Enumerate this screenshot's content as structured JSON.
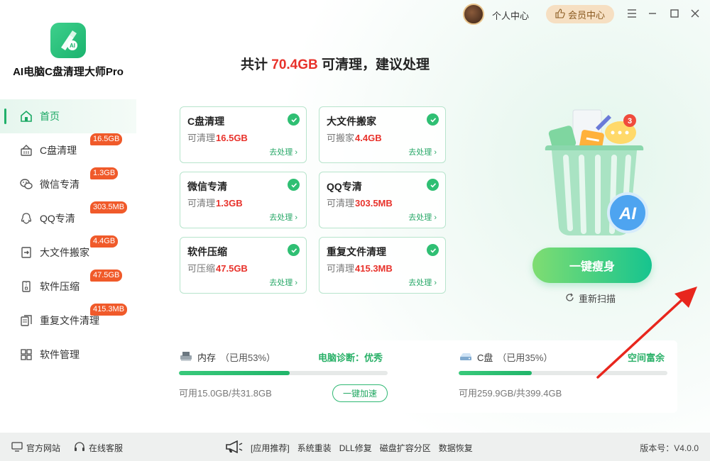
{
  "app": {
    "title": "AI电脑C盘清理大师Pro"
  },
  "topbar": {
    "user_center": "个人中心",
    "vip": "会员中心"
  },
  "sidebar": {
    "items": [
      {
        "label": "首页",
        "badge": ""
      },
      {
        "label": "C盘清理",
        "badge": "16.5GB"
      },
      {
        "label": "微信专清",
        "badge": "1.3GB"
      },
      {
        "label": "QQ专清",
        "badge": "303.5MB"
      },
      {
        "label": "大文件搬家",
        "badge": "4.4GB"
      },
      {
        "label": "软件压缩",
        "badge": "47.5GB"
      },
      {
        "label": "重复文件清理",
        "badge": "415.3MB"
      },
      {
        "label": "软件管理",
        "badge": ""
      }
    ]
  },
  "headline": {
    "prefix": "共计 ",
    "amount": "70.4GB",
    "suffix": " 可清理，建议处理"
  },
  "cards": [
    {
      "title": "C盘清理",
      "sub_label": "可清理",
      "value": "16.5GB",
      "link": "去处理"
    },
    {
      "title": "大文件搬家",
      "sub_label": "可搬家",
      "value": "4.4GB",
      "link": "去处理"
    },
    {
      "title": "微信专清",
      "sub_label": "可清理",
      "value": "1.3GB",
      "link": "去处理"
    },
    {
      "title": "QQ专清",
      "sub_label": "可清理",
      "value": "303.5MB",
      "link": "去处理"
    },
    {
      "title": "软件压缩",
      "sub_label": "可压缩",
      "value": "47.5GB",
      "link": "去处理"
    },
    {
      "title": "重复文件清理",
      "sub_label": "可清理",
      "value": "415.3MB",
      "link": "去处理"
    }
  ],
  "actions": {
    "primary": "一键瘦身",
    "rescan": "重新扫描"
  },
  "stats": {
    "memory": {
      "name": "内存",
      "usage": "（已用53%）",
      "right": "电脑诊断：优秀",
      "used_percent": 53,
      "foot": "可用15.0GB/共31.8GB",
      "button": "一键加速"
    },
    "disk": {
      "name": "C盘",
      "usage": "（已用35%）",
      "right": "空间富余",
      "used_percent": 35,
      "foot": "可用259.9GB/共399.4GB"
    }
  },
  "footer": {
    "official_site": "官方网站",
    "support": "在线客服",
    "links": [
      "[应用推荐]",
      "系统重装",
      "DLL修复",
      "磁盘扩容分区",
      "数据恢复"
    ],
    "version": "版本号：V4.0.0"
  },
  "colors": {
    "accent_green": "#20b06a",
    "danger_red": "#e8322b",
    "badge_orange": "#f05a2a"
  }
}
